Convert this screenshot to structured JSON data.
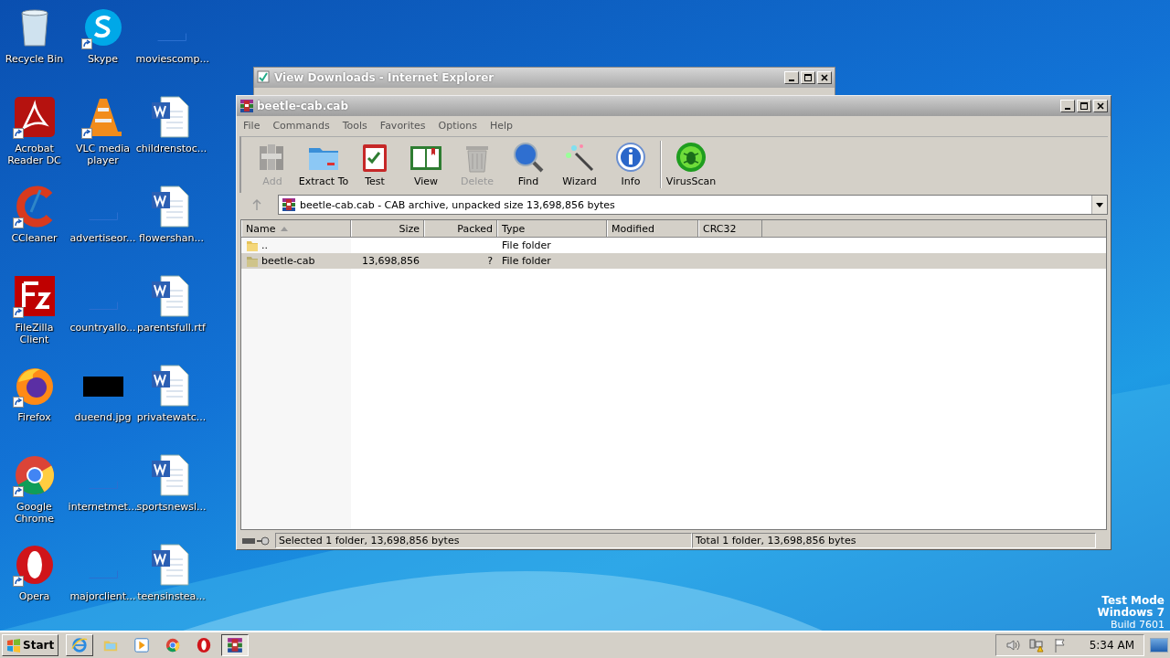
{
  "desktop_icons": [
    {
      "label": "Recycle Bin",
      "kind": "recycle",
      "shortcut": false
    },
    {
      "label": "Acrobat Reader DC",
      "kind": "pdf",
      "shortcut": true
    },
    {
      "label": "CCleaner",
      "kind": "ccleaner",
      "shortcut": true
    },
    {
      "label": "FileZilla Client",
      "kind": "filezilla",
      "shortcut": true
    },
    {
      "label": "Firefox",
      "kind": "firefox",
      "shortcut": true
    },
    {
      "label": "Google Chrome",
      "kind": "chrome",
      "shortcut": true
    },
    {
      "label": "Opera",
      "kind": "opera",
      "shortcut": true
    },
    {
      "label": "Skype",
      "kind": "skype",
      "shortcut": true
    },
    {
      "label": "VLC media player",
      "kind": "vlc",
      "shortcut": true
    },
    {
      "label": "advertiseor...",
      "kind": "blank",
      "shortcut": false
    },
    {
      "label": "countryallo...",
      "kind": "blank",
      "shortcut": false
    },
    {
      "label": "dueend.jpg",
      "kind": "image",
      "shortcut": false
    },
    {
      "label": "internetmet...",
      "kind": "blank",
      "shortcut": false
    },
    {
      "label": "majorclient...",
      "kind": "blank",
      "shortcut": false
    },
    {
      "label": "moviescomp...",
      "kind": "blank",
      "shortcut": false
    },
    {
      "label": "childrenstoc...",
      "kind": "word",
      "shortcut": false
    },
    {
      "label": "flowershan...",
      "kind": "word",
      "shortcut": false
    },
    {
      "label": "parentsfull.rtf",
      "kind": "word",
      "shortcut": false
    },
    {
      "label": "privatewatc...",
      "kind": "word",
      "shortcut": false
    },
    {
      "label": "sportsnewsl...",
      "kind": "word",
      "shortcut": false
    },
    {
      "label": "teensinstea...",
      "kind": "word",
      "shortcut": false
    }
  ],
  "back_window": {
    "title": "View Downloads - Internet Explorer"
  },
  "window": {
    "title": "beetle-cab.cab",
    "menu": [
      "File",
      "Commands",
      "Tools",
      "Favorites",
      "Options",
      "Help"
    ],
    "toolbar": [
      {
        "label": "Add",
        "kind": "add",
        "disabled": true
      },
      {
        "label": "Extract To",
        "kind": "extract",
        "disabled": false
      },
      {
        "label": "Test",
        "kind": "test",
        "disabled": false
      },
      {
        "label": "View",
        "kind": "view",
        "disabled": false
      },
      {
        "label": "Delete",
        "kind": "delete",
        "disabled": true
      },
      {
        "label": "Find",
        "kind": "find",
        "disabled": false
      },
      {
        "label": "Wizard",
        "kind": "wizard",
        "disabled": false
      },
      {
        "label": "Info",
        "kind": "info",
        "disabled": false
      },
      {
        "label": "VirusScan",
        "kind": "virus",
        "disabled": false
      }
    ],
    "address": "beetle-cab.cab - CAB archive, unpacked size 13,698,856 bytes",
    "columns": [
      {
        "label": "Name",
        "sorted": true
      },
      {
        "label": "Size",
        "sorted": false
      },
      {
        "label": "Packed",
        "sorted": false
      },
      {
        "label": "Type",
        "sorted": false
      },
      {
        "label": "Modified",
        "sorted": false
      },
      {
        "label": "CRC32",
        "sorted": false
      }
    ],
    "rows": [
      {
        "name": "..",
        "size": "",
        "packed": "",
        "type": "File folder",
        "selected": false
      },
      {
        "name": "beetle-cab",
        "size": "13,698,856",
        "packed": "?",
        "type": "File folder",
        "selected": true
      }
    ],
    "status_left": "Selected 1 folder, 13,698,856 bytes",
    "status_right": "Total 1 folder, 13,698,856 bytes"
  },
  "os_notice": [
    "Test Mode",
    "Windows 7",
    "Build 7601"
  ],
  "taskbar": {
    "start": "Start",
    "apps": [
      {
        "kind": "ie",
        "active": false,
        "framed": true
      },
      {
        "kind": "explorer",
        "active": false,
        "framed": false
      },
      {
        "kind": "media",
        "active": false,
        "framed": false
      },
      {
        "kind": "chrome",
        "active": false,
        "framed": false
      },
      {
        "kind": "opera",
        "active": false,
        "framed": false
      },
      {
        "kind": "winrar",
        "active": true,
        "framed": true
      }
    ],
    "clock": "5:34 AM"
  }
}
